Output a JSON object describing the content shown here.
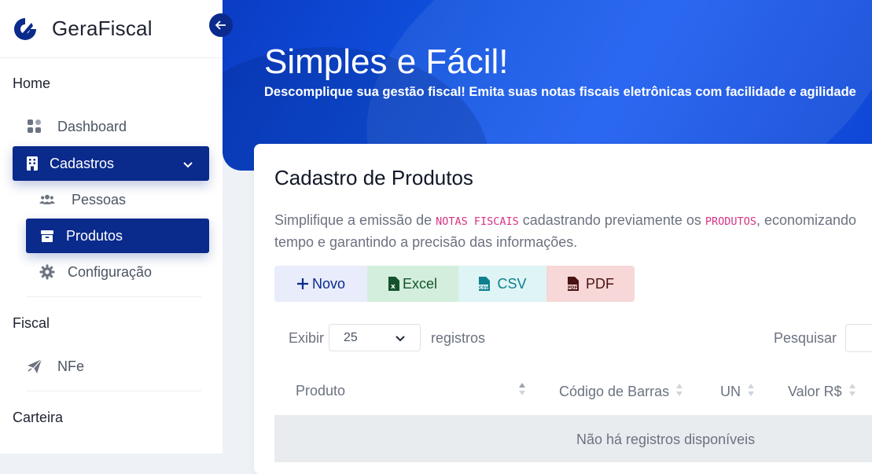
{
  "brand": {
    "name": "GeraFiscal",
    "logo_icon": "gerafiscal-logo-icon"
  },
  "sidebar": {
    "sections": [
      {
        "title": "Home"
      },
      {
        "title": "Fiscal"
      },
      {
        "title": "Carteira"
      }
    ],
    "items": [
      {
        "label": "Dashboard",
        "icon": "dashboard-grid-icon"
      },
      {
        "label": "Cadastros",
        "icon": "building-icon",
        "active": true,
        "expanded": true
      },
      {
        "label": "Pessoas",
        "icon": "users-icon"
      },
      {
        "label": "Produtos",
        "icon": "box-icon",
        "active": true
      },
      {
        "label": "Configuração",
        "icon": "gear-icon"
      },
      {
        "label": "NFe",
        "icon": "paper-plane-icon"
      }
    ]
  },
  "hero": {
    "title": "Simples e Fácil!",
    "subtitle": "Descomplique sua gestão fiscal! Emita suas notas fiscais eletrônicas com facilidade e agilidade"
  },
  "card": {
    "title": "Cadastro de Produtos",
    "desc_pre": "Simplifique a emissão de ",
    "desc_code1": "NOTAS FISCAIS",
    "desc_mid": " cadastrando previamente os ",
    "desc_code2": "PRODUTOS",
    "desc_post": ", economizando tempo e garantindo a precisão das informações."
  },
  "toolbar": {
    "novo": "Novo",
    "excel": "Excel",
    "csv": "CSV",
    "pdf": "PDF"
  },
  "table_controls": {
    "exibir": "Exibir",
    "page_size": "25",
    "registros": "registros",
    "pesquisar": "Pesquisar"
  },
  "table": {
    "columns": [
      "Produto",
      "Código de Barras",
      "UN",
      "Valor R$"
    ],
    "empty": "Não há registros disponíveis"
  },
  "colors": {
    "primary": "#0a2a8c",
    "hero": "#1550e8"
  }
}
